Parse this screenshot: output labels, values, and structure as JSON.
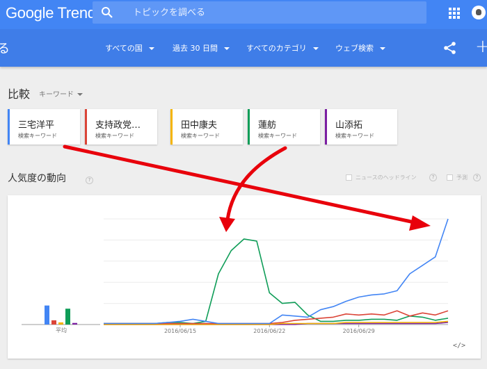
{
  "app": {
    "logo": "Google Trends"
  },
  "search": {
    "placeholder": "トピックを調べる"
  },
  "filters": {
    "back_fragment": "る",
    "region": "すべての国",
    "period": "過去 30 日間",
    "category": "すべてのカテゴリ",
    "search_type": "ウェブ検索"
  },
  "compare": {
    "title": "比較",
    "type_label": "キーワード"
  },
  "terms": [
    {
      "term": "三宅洋平",
      "sub": "検索キーワード",
      "color": "#4285f4"
    },
    {
      "term": "支持政党…",
      "sub": "検索キーワード",
      "color": "#db4437"
    },
    {
      "term": "田中康夫",
      "sub": "検索キーワード",
      "color": "#f4b400"
    },
    {
      "term": "蓮舫",
      "sub": "検索キーワード",
      "color": "#0f9d58"
    },
    {
      "term": "山添拓",
      "sub": "検索キーワード",
      "color": "#7b1fa2"
    }
  ],
  "interest": {
    "title": "人気度の動向",
    "headlines_label": "ニュースのヘッドライン",
    "forecast_label": "予測",
    "embed_label": "</>"
  },
  "annotation": {
    "arrow_color": "#e8000b"
  },
  "chart_data": {
    "type": "line",
    "average_label": "平均",
    "averages": [
      {
        "color": "#4285f4",
        "value": 18
      },
      {
        "color": "#db4437",
        "value": 4
      },
      {
        "color": "#f4b400",
        "value": 2
      },
      {
        "color": "#0f9d58",
        "value": 15
      },
      {
        "color": "#7b1fa2",
        "value": 1.5
      }
    ],
    "x_ticks": [
      {
        "day": 6,
        "label": "2016/06/15"
      },
      {
        "day": 13,
        "label": "2016/06/22"
      },
      {
        "day": 20,
        "label": "2016/06/29"
      }
    ],
    "ylim": [
      0,
      100
    ],
    "gridlines": 5,
    "series": [
      {
        "color": "#4285f4",
        "values": [
          1,
          1,
          1,
          1,
          1,
          2,
          3,
          5,
          3,
          1,
          1,
          1,
          1,
          1,
          9,
          8,
          7,
          14,
          17,
          22,
          26,
          28,
          29,
          32,
          48,
          56,
          64,
          100
        ]
      },
      {
        "color": "#db4437",
        "values": [
          1,
          1,
          1,
          1,
          1,
          1,
          1,
          1,
          1,
          1,
          1,
          1,
          1,
          1,
          2,
          4,
          5,
          6,
          7,
          10,
          9,
          10,
          9,
          13,
          8,
          11,
          9,
          13
        ]
      },
      {
        "color": "#f4b400",
        "values": [
          0,
          0,
          0,
          0,
          0,
          0,
          0,
          0,
          0,
          0,
          0,
          0,
          0,
          0,
          1,
          1,
          1,
          1,
          1,
          2,
          2,
          2,
          2,
          2,
          2,
          2,
          2,
          3
        ]
      },
      {
        "color": "#0f9d58",
        "values": [
          1,
          1,
          1,
          1,
          1,
          2,
          2,
          1,
          3,
          48,
          70,
          81,
          79,
          30,
          20,
          21,
          9,
          3,
          3,
          4,
          4,
          5,
          5,
          4,
          8,
          7,
          4,
          6
        ]
      },
      {
        "color": "#7b1fa2",
        "values": [
          0,
          0,
          0,
          0,
          0,
          0,
          0,
          0,
          0,
          0,
          0,
          0,
          0,
          0,
          0,
          0,
          1,
          1,
          1,
          1,
          1,
          1,
          1,
          1,
          1,
          1,
          1,
          2
        ]
      }
    ]
  }
}
